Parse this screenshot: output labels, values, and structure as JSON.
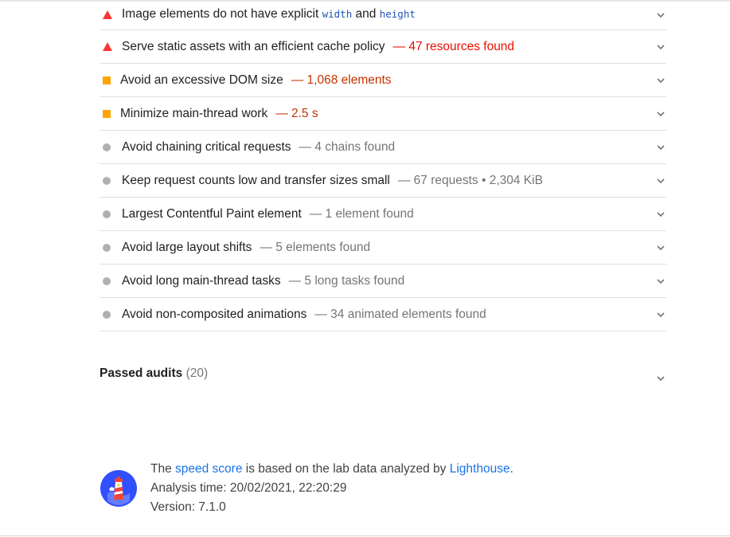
{
  "audits": [
    {
      "severity": "fail",
      "title_before": "Image elements do not have explicit ",
      "code1": "width",
      "title_mid": " and ",
      "code2": "height",
      "display": ""
    },
    {
      "severity": "fail",
      "title": "Serve static assets with an efficient cache policy",
      "display": "— 47 resources found"
    },
    {
      "severity": "average",
      "title": "Avoid an excessive DOM size",
      "display": "— 1,068 elements"
    },
    {
      "severity": "average",
      "title": "Minimize main-thread work",
      "display": "— 2.5 s"
    },
    {
      "severity": "info",
      "title": "Avoid chaining critical requests",
      "display": "— 4 chains found"
    },
    {
      "severity": "info",
      "title": "Keep request counts low and transfer sizes small",
      "display": "— 67 requests • 2,304 KiB"
    },
    {
      "severity": "info",
      "title": "Largest Contentful Paint element",
      "display": "— 1 element found"
    },
    {
      "severity": "info",
      "title": "Avoid large layout shifts",
      "display": "— 5 elements found"
    },
    {
      "severity": "info",
      "title": "Avoid long main-thread tasks",
      "display": "— 5 long tasks found"
    },
    {
      "severity": "info",
      "title": "Avoid non-composited animations",
      "display": "— 34 animated elements found"
    }
  ],
  "passed": {
    "label": "Passed audits",
    "count": "(20)"
  },
  "footer": {
    "text_the": "The ",
    "link_speed": "speed score",
    "text_mid": " is based on the lab data analyzed by ",
    "link_lighthouse": "Lighthouse",
    "text_end": ".",
    "analysis_time": "Analysis time: 20/02/2021, 22:20:29",
    "version": "Version: 7.1.0"
  },
  "colors": {
    "fail": "#ff3333",
    "average": "#ffa400",
    "info": "#b0b0b0",
    "link": "#1a73e8"
  }
}
